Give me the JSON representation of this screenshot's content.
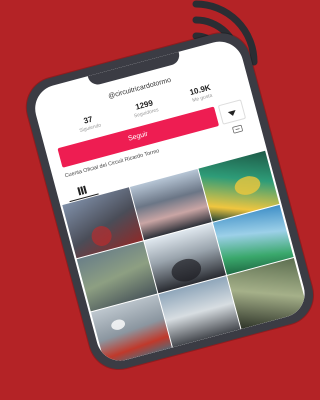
{
  "profile": {
    "username": "@circuitricardotormo",
    "stats": [
      {
        "value": "37",
        "label": "Siguiendo"
      },
      {
        "value": "1299",
        "label": "Seguidores"
      },
      {
        "value": "10.9K",
        "label": "Me gusta"
      }
    ],
    "follow_label": "Seguir",
    "bio": "Cuenta Oficial del Circuit Ricardo Tormo"
  },
  "videos": [
    {
      "views": ""
    },
    {
      "views": ""
    },
    {
      "views": ""
    },
    {
      "views": ""
    },
    {
      "views": ""
    },
    {
      "views": ""
    },
    {
      "views": ""
    },
    {
      "views": ""
    },
    {
      "views": ""
    }
  ],
  "colors": {
    "background": "#b42326",
    "phone_frame": "#3b3c44",
    "follow_button": "#ee1d52",
    "signal_arcs": "#2b2d33"
  },
  "icons": [
    "wifi-signal-icon",
    "chevron-down-icon",
    "link-icon",
    "grid-icon"
  ]
}
